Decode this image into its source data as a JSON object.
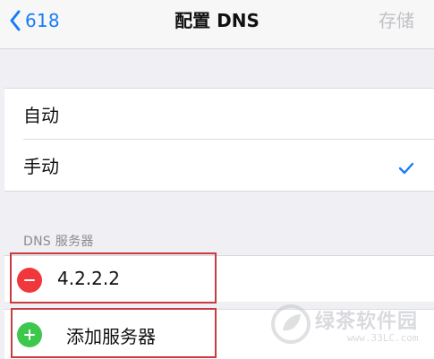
{
  "nav": {
    "back_label": "618",
    "title": "配置 DNS",
    "save_label": "存储"
  },
  "mode_options": [
    {
      "label": "自动",
      "selected": false
    },
    {
      "label": "手动",
      "selected": true
    }
  ],
  "dns_section": {
    "header": "DNS 服务器",
    "servers": [
      "4.2.2.2"
    ],
    "add_label": "添加服务器"
  },
  "watermark": {
    "title": "绿茶软件园",
    "url": "www.33LC.com"
  },
  "colors": {
    "accent": "#1a7cf5",
    "delete": "#f0373b",
    "add": "#3cc84c",
    "highlight_box": "#c83b3f",
    "save_disabled": "#c2c2c6"
  },
  "icons": {
    "back": "chevron-left-icon",
    "selected": "checkmark-icon",
    "delete": "minus-circle-icon",
    "add": "plus-circle-icon"
  }
}
